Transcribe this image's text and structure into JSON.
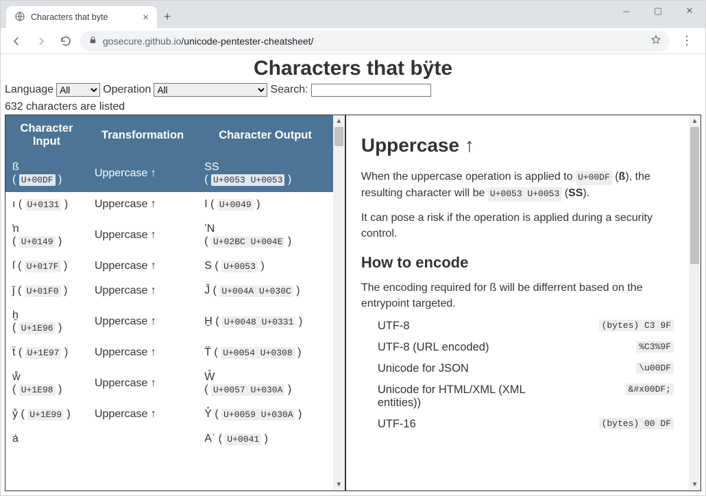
{
  "browser": {
    "tab_title": "Characters that byte",
    "url_host": "gosecure.github.io",
    "url_path": "/unicode-pentester-cheatsheet/"
  },
  "page": {
    "title": "Characters that bÿte",
    "labels": {
      "language": "Language",
      "operation": "Operation",
      "search": "Search:"
    },
    "selects": {
      "language_value": "All",
      "operation_value": "All"
    },
    "count_text": "632 characters are listed",
    "table": {
      "headers": [
        "Character Input",
        "Transformation",
        "Character Output"
      ],
      "rows": [
        {
          "in_char": "ß",
          "in_code": "U+00DF",
          "xf": "Uppercase ↑",
          "out_char": "SS",
          "out_code": "U+0053 U+0053",
          "wrap_in": true,
          "wrap_out": true,
          "selected": true
        },
        {
          "in_char": "ı",
          "in_code": "U+0131",
          "xf": "Uppercase ↑",
          "out_char": "I",
          "out_code": "U+0049"
        },
        {
          "in_char": "ŉ",
          "in_code": "U+0149",
          "xf": "Uppercase ↑",
          "out_char": "ʼN",
          "out_code": "U+02BC U+004E",
          "wrap_in": true,
          "wrap_out": true
        },
        {
          "in_char": "ſ",
          "in_code": "U+017F",
          "xf": "Uppercase ↑",
          "out_char": "S",
          "out_code": "U+0053"
        },
        {
          "in_char": "ǰ",
          "in_code": "U+01F0",
          "xf": "Uppercase ↑",
          "out_char": "J̌",
          "out_code": "U+004A U+030C"
        },
        {
          "in_char": "ẖ",
          "in_code": "U+1E96",
          "xf": "Uppercase ↑",
          "out_char": "H̱",
          "out_code": "U+0048 U+0331",
          "wrap_in": true
        },
        {
          "in_char": "ẗ",
          "in_code": "U+1E97",
          "xf": "Uppercase ↑",
          "out_char": "T̈",
          "out_code": "U+0054 U+0308"
        },
        {
          "in_char": "ẘ",
          "in_code": "U+1E98",
          "xf": "Uppercase ↑",
          "out_char": "W̊",
          "out_code": "U+0057 U+030A",
          "wrap_in": true,
          "wrap_out": true
        },
        {
          "in_char": "ẙ",
          "in_code": "U+1E99",
          "xf": "Uppercase ↑",
          "out_char": "Y̊",
          "out_code": "U+0059 U+030A"
        },
        {
          "in_char": "ẚ",
          "in_code": "",
          "xf": "",
          "out_char": "Aʾ",
          "out_code": "U+0041"
        }
      ]
    }
  },
  "detail": {
    "heading": "Uppercase ↑",
    "p1_pre": "When the uppercase operation is applied to ",
    "p1_code1": "U+00DF",
    "p1_mid1": " (",
    "p1_char1": "ß",
    "p1_mid2": "), the resulting character will be ",
    "p1_code2": "U+0053 U+0053",
    "p1_mid3": " (",
    "p1_char2": "SS",
    "p1_end": ").",
    "p2": "It can pose a risk if the operation is applied during a security control.",
    "h3": "How to encode",
    "p3": "The encoding required for ß will be differrent based on the entrypoint targeted.",
    "encodings": [
      {
        "label": "UTF-8",
        "value": "(bytes) C3 9F"
      },
      {
        "label": "UTF-8 (URL encoded)",
        "value": "%C3%9F"
      },
      {
        "label": "Unicode for JSON",
        "value": "\\u00DF"
      },
      {
        "label": "Unicode for HTML/XML (XML entities))",
        "value": "&#x00DF;"
      },
      {
        "label": "UTF-16",
        "value": "(bytes) 00 DF"
      }
    ]
  }
}
